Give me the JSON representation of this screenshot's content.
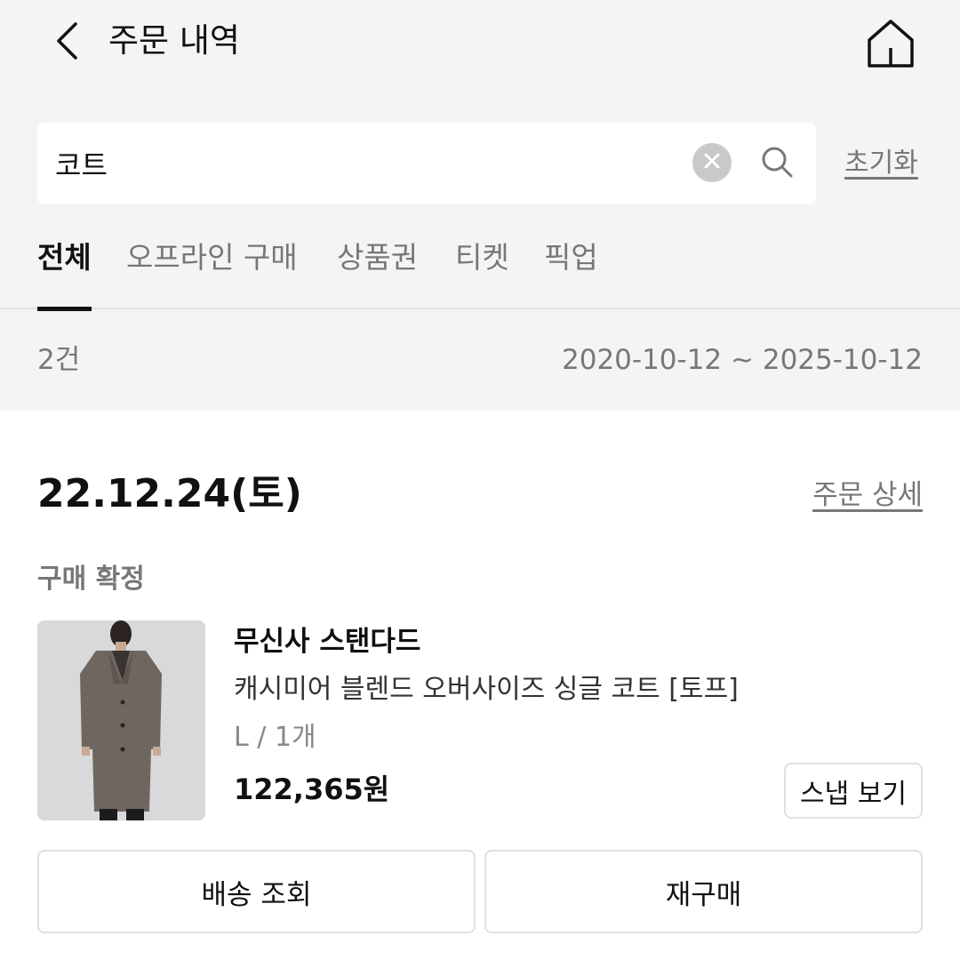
{
  "header": {
    "title": "주문 내역",
    "back_icon": "chevron-left-icon",
    "home_icon": "home-icon"
  },
  "search": {
    "value": "코트",
    "clear_icon": "close-icon",
    "search_icon": "search-icon",
    "reset_label": "초기화"
  },
  "tabs": [
    {
      "label": "전체",
      "active": true
    },
    {
      "label": "오프라인 구매",
      "active": false
    },
    {
      "label": "상품권",
      "active": false
    },
    {
      "label": "티켓",
      "active": false
    },
    {
      "label": "픽업",
      "active": false
    }
  ],
  "summary": {
    "count": "2건",
    "date_range": "2020-10-12 ~ 2025-10-12"
  },
  "order": {
    "date": "22.12.24(토)",
    "detail_link": "주문 상세",
    "status": "구매 확정",
    "item": {
      "brand": "무신사 스탠다드",
      "name": "캐시미어 블렌드 오버사이즈 싱글 코트 [토프]",
      "option": "L / 1개",
      "price": "122,365원",
      "snap_button": "스냅 보기"
    },
    "actions": {
      "track_delivery": "배송 조회",
      "reorder": "재구매"
    }
  },
  "colors": {
    "background_top": "#f4f4f4",
    "text_primary": "#111111",
    "text_secondary": "#777777",
    "border": "#e0e0e0",
    "coat": "#6f6660"
  }
}
